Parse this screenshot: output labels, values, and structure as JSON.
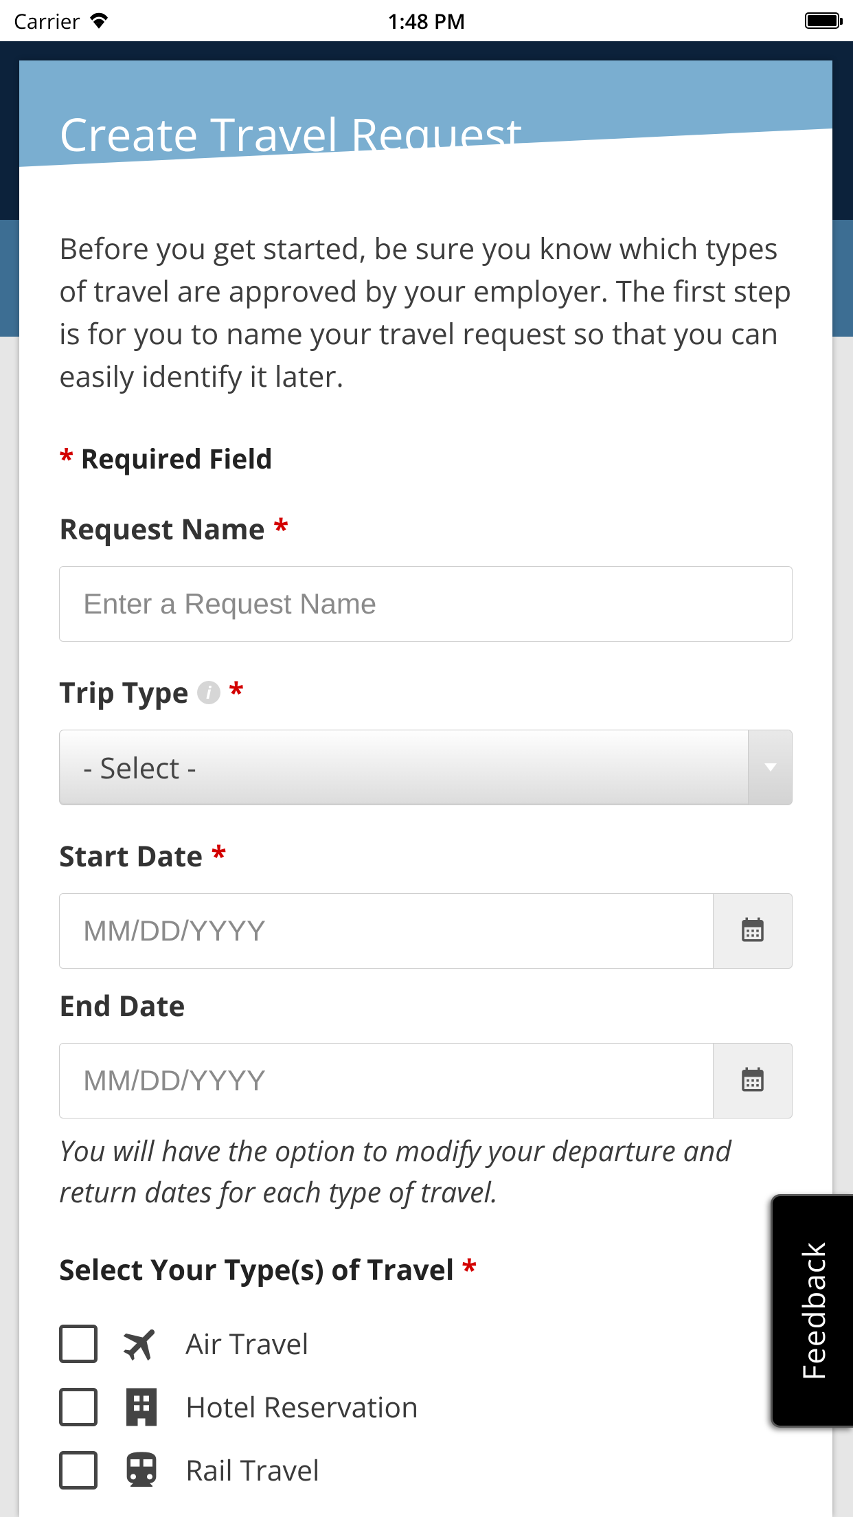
{
  "status_bar": {
    "carrier": "Carrier",
    "time": "1:48 PM"
  },
  "modal": {
    "title": "Create Travel Request",
    "intro": "Before you get started, be sure you know which types of travel are approved by your employer. The first step is for you to name your travel request so that you can easily identify it later.",
    "required_note": "Required Field",
    "fields": {
      "request_name": {
        "label": "Request Name",
        "placeholder": "Enter a Request Name"
      },
      "trip_type": {
        "label": "Trip Type",
        "selected": "- Select -"
      },
      "start_date": {
        "label": "Start Date",
        "placeholder": "MM/DD/YYYY"
      },
      "end_date": {
        "label": "End Date",
        "placeholder": "MM/DD/YYYY"
      }
    },
    "date_note": "You will have the option to modify your departure and return dates for each type of travel.",
    "travel_types": {
      "label": "Select Your Type(s) of Travel",
      "options": [
        {
          "label": "Air Travel",
          "icon": "plane-icon"
        },
        {
          "label": "Hotel Reservation",
          "icon": "hotel-icon"
        },
        {
          "label": "Rail Travel",
          "icon": "train-icon"
        }
      ]
    }
  },
  "feedback": "Feedback"
}
